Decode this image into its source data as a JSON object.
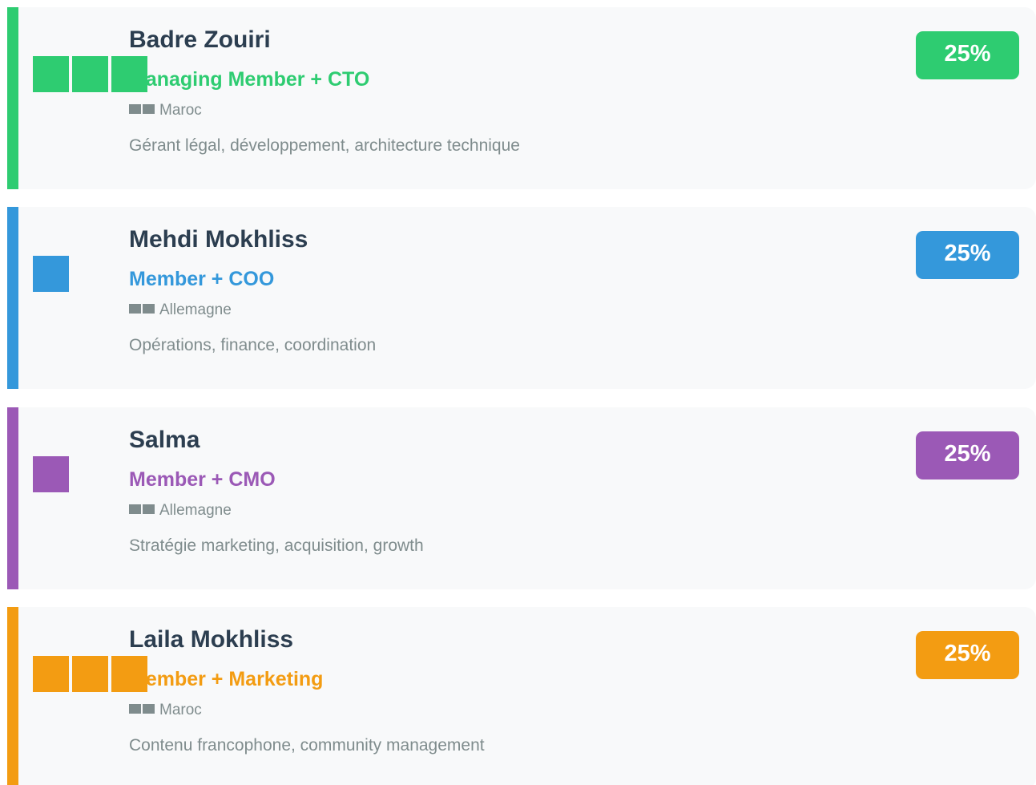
{
  "members": [
    {
      "name": "Badre Zouiri",
      "role": "Managing Member + CTO",
      "location": "Maroc",
      "description": "Gérant légal, développement, architecture technique",
      "share": "25%",
      "color": "#2ecc71",
      "avatar_blocks": 3,
      "flag_icon": "flag-icon"
    },
    {
      "name": "Mehdi Mokhliss",
      "role": "Member + COO",
      "location": "Allemagne",
      "description": "Opérations, finance, coordination",
      "share": "25%",
      "color": "#3498db",
      "avatar_blocks": 1,
      "flag_icon": "flag-icon"
    },
    {
      "name": "Salma",
      "role": "Member + CMO",
      "location": "Allemagne",
      "description": "Stratégie marketing, acquisition, growth",
      "share": "25%",
      "color": "#9b59b6",
      "avatar_blocks": 1,
      "flag_icon": "flag-icon"
    },
    {
      "name": "Laila Mokhliss",
      "role": "Member + Marketing",
      "location": "Maroc",
      "description": "Contenu francophone, community management",
      "share": "25%",
      "color": "#f39c12",
      "avatar_blocks": 3,
      "flag_icon": "flag-icon"
    }
  ]
}
